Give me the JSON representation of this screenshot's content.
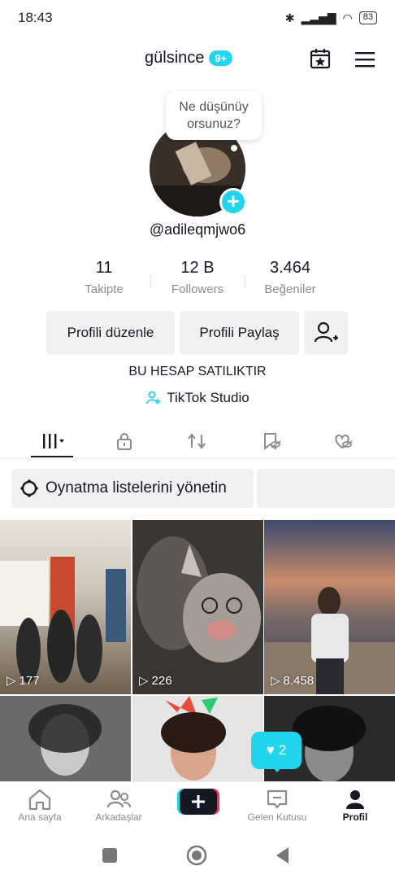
{
  "status": {
    "time": "18:43",
    "battery": "83"
  },
  "header": {
    "username": "gülsince",
    "badge": "9+"
  },
  "profile": {
    "bubble_line1": "Ne düşünüy",
    "bubble_line2": "orsunuz?",
    "handle": "@adileqmjwo6",
    "bio": "BU HESAP SATILIKTIR",
    "studio_link": "TikTok Studio"
  },
  "stats": [
    {
      "value": "11",
      "label": "Takipte"
    },
    {
      "value": "12 B",
      "label": "Followers"
    },
    {
      "value": "3.464",
      "label": "Beğeniler"
    }
  ],
  "buttons": {
    "edit": "Profili düzenle",
    "share": "Profili Paylaş"
  },
  "playlists": {
    "label": "Oynatma listelerini yönetin"
  },
  "videos": [
    {
      "views": "177"
    },
    {
      "views": "226"
    },
    {
      "views": "8.458"
    }
  ],
  "like_popup": {
    "count": "2"
  },
  "nav": {
    "home": "Ana sayfa",
    "friends": "Arkadaşlar",
    "inbox": "Gelen Kutusu",
    "profile": "Profil"
  },
  "colors": {
    "accent": "#20d5ec",
    "text": "#161823",
    "muted": "#8a8b91"
  }
}
